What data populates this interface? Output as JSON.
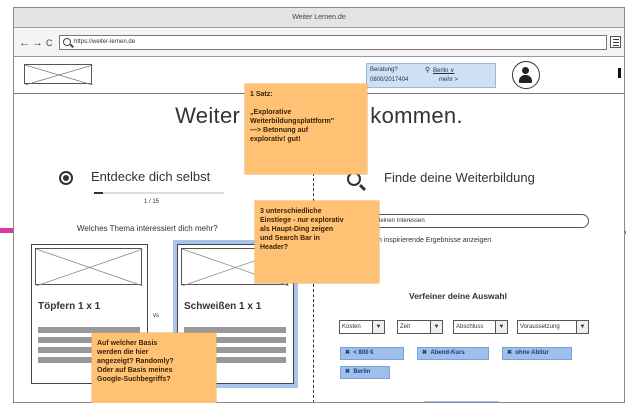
{
  "window": {
    "title": "Weiter Lernen.de"
  },
  "browser": {
    "back": "←",
    "forward": "→",
    "reload": "C",
    "url": "https://weiter-lernen.de"
  },
  "header": {
    "contact_label": "Beratung?",
    "contact_phone": "0800/2017404",
    "location_label": "Berlin ∨",
    "more_label": "mehr >"
  },
  "hero": {
    "headline_left": "Weiter le",
    "headline_right": "r kommen."
  },
  "discover": {
    "title": "Entdecke dich selbst",
    "progress_text": "1 / 15",
    "progress_fraction": 0.07,
    "question": "Welches Thema interessiert dich mehr?",
    "vs_label": "vs",
    "cards": [
      {
        "title": "Töpfern 1 x 1",
        "selected": false
      },
      {
        "title": "Schweißen 1 x 1",
        "selected": true
      }
    ]
  },
  "find": {
    "title": "Finde deine Weiterbildung",
    "search_text": "ch deinen Interessen",
    "inspire_text": "ätzlich inspirierende Ergebnisse anzeigen",
    "refine_title": "Verfeiner deine Auswahl",
    "filters": [
      "Kosten",
      "Zeit",
      "Abschluss",
      "Voraussetzung"
    ],
    "chips": [
      "< 800 €",
      "Abend-Kurs",
      "ohne Abitur",
      "Berlin"
    ]
  },
  "notes": [
    "1 Satz:\n\n„Explorative\nWeiterbildungsplattform\"\n—> Betonung auf\nexplorativ! gut!",
    "3 unterschiedliche\nEinstiege - nur explorativ\nals Haupt-Ding zeigen\nund Search Bar in\nHeader?",
    "Auf welcher Basis\nwerden die hier\nangezeigt? Randomly?\nOder auf Basis meines\nGoogle-Suchbegriffs?"
  ],
  "colors": {
    "sticky": "#ffc174",
    "accent_blue": "#9fc0ec",
    "arrow_pink": "#e0379c"
  }
}
